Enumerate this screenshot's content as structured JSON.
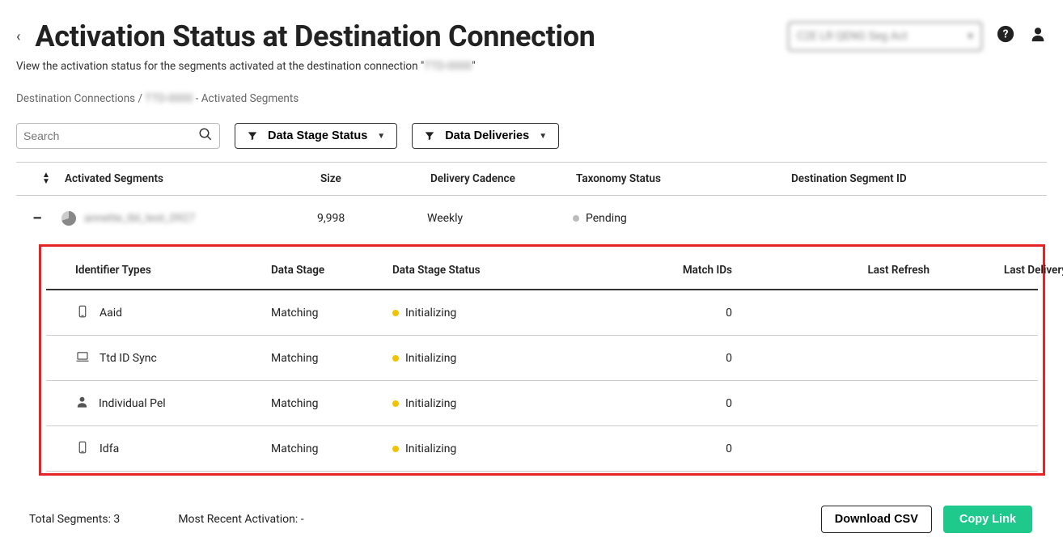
{
  "header": {
    "title": "Activation Status at Destination Connection",
    "subtitle_pre": "View the activation status for the segments activated at the destination connection \"",
    "subtitle_blur": "TTD-0000",
    "subtitle_post": "\"",
    "dropdown_text": "C2E LR QENG Seg Act"
  },
  "breadcrumb": {
    "root": "Destination Connections",
    "sep": "  /  ",
    "blur": "TTD-0000",
    "tail": " - Activated Segments"
  },
  "controls": {
    "search_placeholder": "Search",
    "filter1": "Data Stage Status",
    "filter2": "Data Deliveries"
  },
  "main_columns": {
    "c1": "Activated Segments",
    "c2": "Size",
    "c3": "Delivery Cadence",
    "c4": "Taxonomy Status",
    "c5": "Destination Segment ID"
  },
  "segment": {
    "name_blur": "annette_tbl_test_0927",
    "size": "9,998",
    "cadence": "Weekly",
    "tax_status": "Pending"
  },
  "detail_columns": {
    "c1": "Identifier Types",
    "c2": "Data Stage",
    "c3": "Data Stage Status",
    "c4": "Match IDs",
    "c5": "Last Refresh",
    "c6": "Last Delivery"
  },
  "details": [
    {
      "icon": "phone",
      "type": "Aaid",
      "stage": "Matching",
      "status": "Initializing",
      "match": "0",
      "refresh": "",
      "delivery": ""
    },
    {
      "icon": "laptop",
      "type": "Ttd ID Sync",
      "stage": "Matching",
      "status": "Initializing",
      "match": "0",
      "refresh": "",
      "delivery": ""
    },
    {
      "icon": "person",
      "type": "Individual Pel",
      "stage": "Matching",
      "status": "Initializing",
      "match": "0",
      "refresh": "",
      "delivery": ""
    },
    {
      "icon": "phone",
      "type": "Idfa",
      "stage": "Matching",
      "status": "Initializing",
      "match": "0",
      "refresh": "",
      "delivery": ""
    }
  ],
  "footer": {
    "total": "Total Segments: 3",
    "recent": "Most Recent Activation: -",
    "download": "Download CSV",
    "copy": "Copy Link"
  }
}
